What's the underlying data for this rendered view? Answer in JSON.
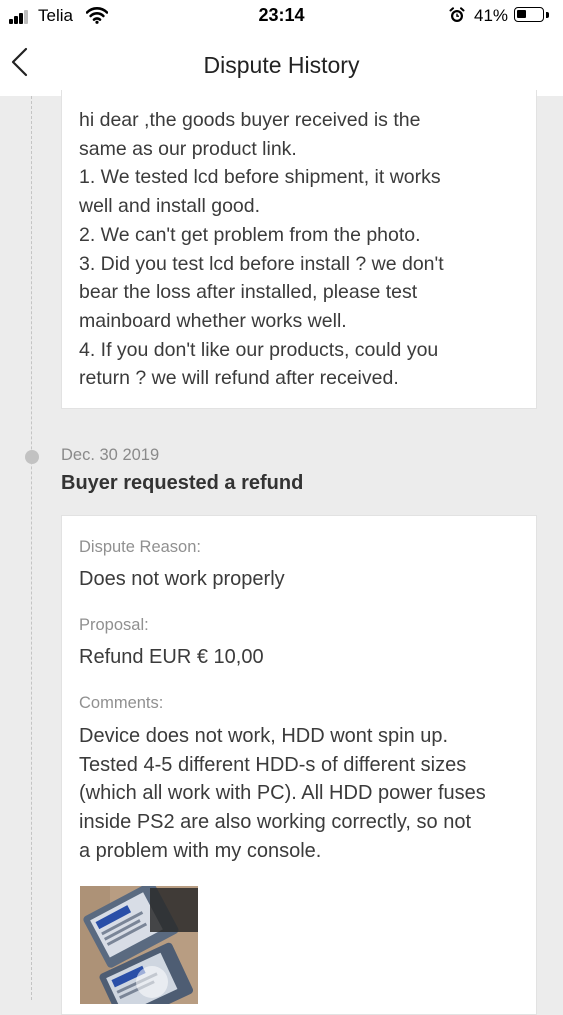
{
  "status_bar": {
    "carrier": "Telia",
    "time": "23:14",
    "battery_percent": "41%",
    "battery_level": 0.41,
    "icons": [
      "signal-icon",
      "wifi-icon",
      "alarm-icon",
      "battery-icon"
    ]
  },
  "header": {
    "title": "Dispute History",
    "back_icon": "chevron-left-icon"
  },
  "seller_response": {
    "lines": [
      "hi dear ,the goods buyer received is the",
      "same as our product link.",
      "1. We tested lcd before shipment, it works",
      "well and install good.",
      "2. We can't get problem from the photo.",
      "3. Did you test lcd before install ? we don't",
      "bear the loss after installed, please test",
      "mainboard whether works well.",
      "4. If you don't like our products, could you",
      "return ? we will refund after received."
    ]
  },
  "buyer_event": {
    "date": "Dec. 30 2019",
    "title": "Buyer requested a refund",
    "reason_label": "Dispute Reason:",
    "reason_value": "Does not work properly",
    "proposal_label": "Proposal:",
    "proposal_value": "Refund EUR € 10,00",
    "comments_label": "Comments:",
    "comments_lines": [
      "Device does not work, HDD wont spin up.",
      "Tested 4-5 different HDD-s of different sizes",
      "(which all work with PC). All HDD power fuses",
      "inside PS2 are also working correctly, so not",
      "a problem with my console."
    ]
  },
  "colors": {
    "background": "#ececec",
    "card": "#ffffff",
    "text": "#3b3b3b",
    "muted": "#909090",
    "timeline": "#c2c2c2"
  }
}
